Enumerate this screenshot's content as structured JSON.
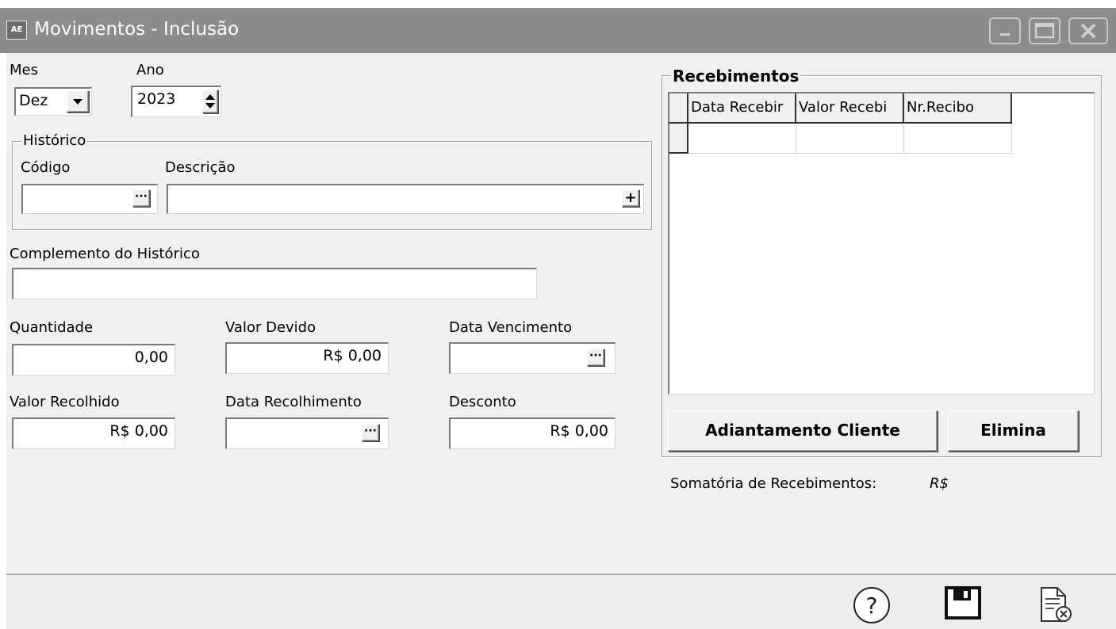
{
  "window": {
    "title": "Movimentos - Inclusão",
    "icon_text": "AE",
    "controls": [
      "minimize-icon",
      "maximize-icon",
      "close-icon"
    ]
  },
  "period": {
    "mes_label": "Mes",
    "mes_value": "Dez",
    "ano_label": "Ano",
    "ano_value": "2023"
  },
  "historico": {
    "group_title": "Histórico",
    "codigo_label": "Código",
    "codigo_value": "",
    "descricao_label": "Descrição",
    "descricao_value": ""
  },
  "complemento": {
    "label": "Complemento do Histórico",
    "value": ""
  },
  "fields": {
    "quantidade_label": "Quantidade",
    "quantidade_value": "0,00",
    "valor_devido_label": "Valor Devido",
    "valor_devido_value": "R$ 0,00",
    "data_vencimento_label": "Data Vencimento",
    "data_vencimento_value": "",
    "valor_recolhido_label": "Valor Recolhido",
    "valor_recolhido_value": "R$ 0,00",
    "data_recolhimento_label": "Data Recolhimento",
    "data_recolhimento_value": "",
    "desconto_label": "Desconto",
    "desconto_value": "R$ 0,00"
  },
  "recebimentos": {
    "group_title": "Recebimentos",
    "columns": [
      "Data Recebir",
      "Valor Recebi",
      "Nr.Recibo"
    ],
    "rows": [
      [
        "",
        "",
        ""
      ]
    ],
    "adiantamento_button": "Adiantamento Cliente",
    "elimina_button": "Elimina",
    "somatoria_label": "Somatória de Recebimentos:",
    "somatoria_value": "R$"
  },
  "footer": {
    "icons": [
      "help-icon",
      "save-icon",
      "cancel-document-icon"
    ],
    "help_glyph": "?"
  }
}
